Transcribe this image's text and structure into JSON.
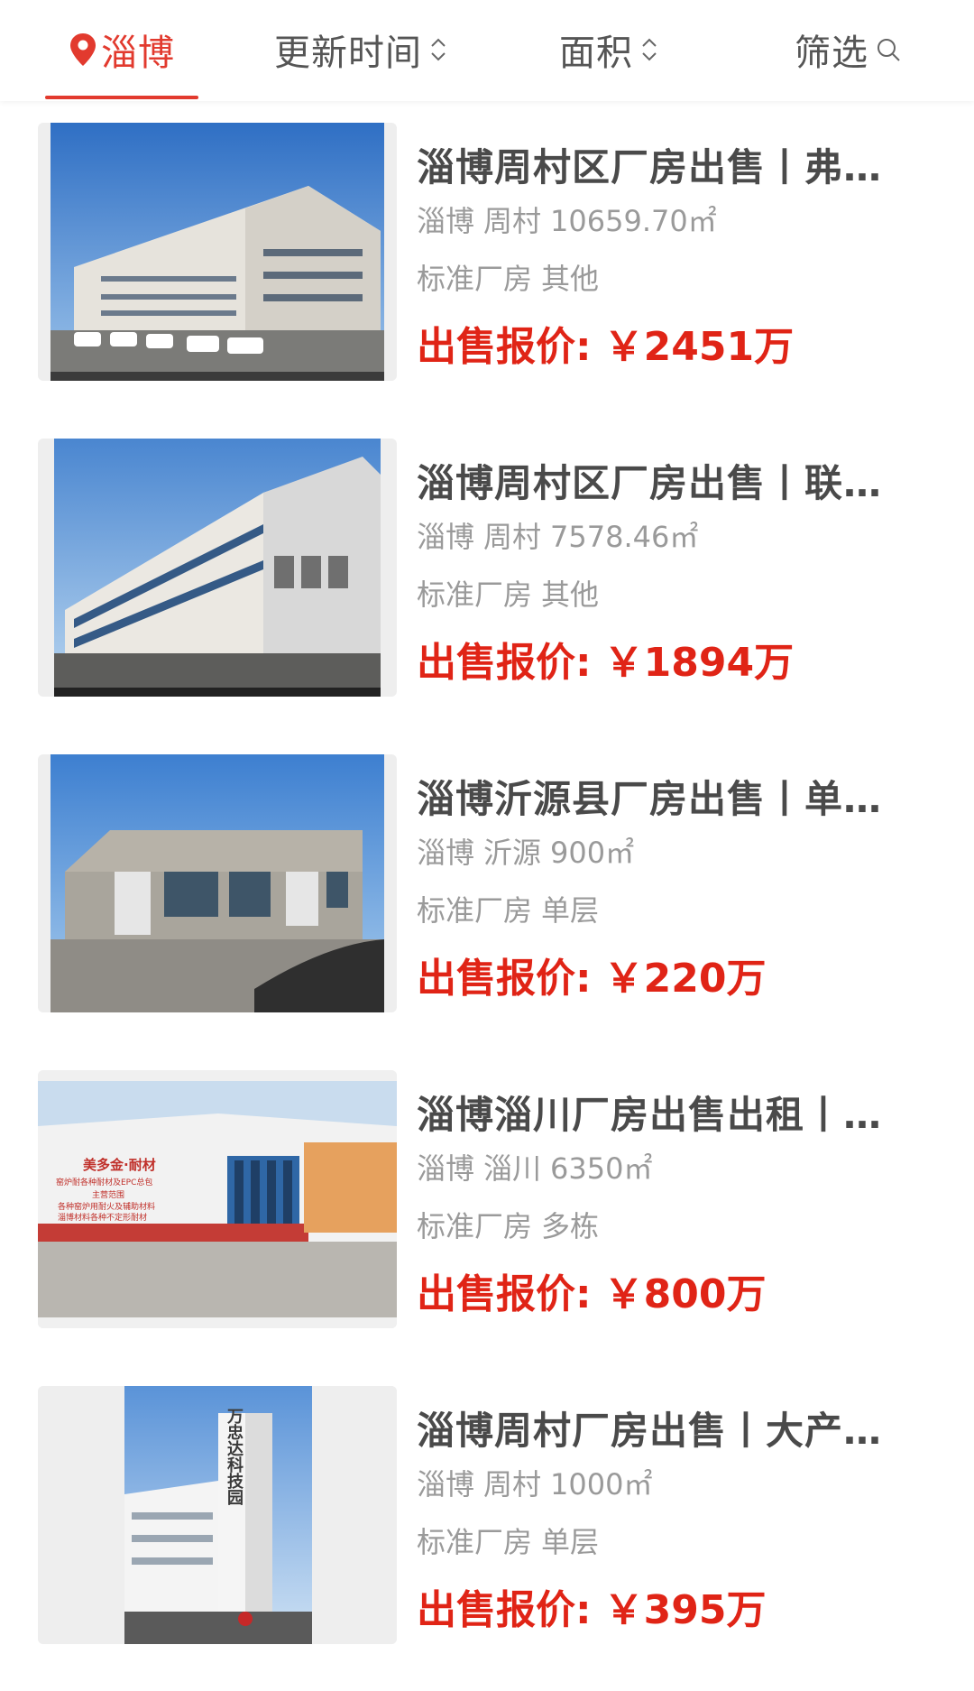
{
  "filters": {
    "city": "淄博",
    "time": "更新时间",
    "area": "面积",
    "filter": "筛选"
  },
  "listings": [
    {
      "title": "淄博周村区厂房出售丨弗…",
      "city": "淄博",
      "district": "周村",
      "area": "10659.70㎡",
      "type": "标准厂房",
      "structure": "其他",
      "price_label": "出售报价:",
      "price": "￥2451万"
    },
    {
      "title": "淄博周村区厂房出售丨联…",
      "city": "淄博",
      "district": "周村",
      "area": "7578.46㎡",
      "type": "标准厂房",
      "structure": "其他",
      "price_label": "出售报价:",
      "price": "￥1894万"
    },
    {
      "title": "淄博沂源县厂房出售丨单…",
      "city": "淄博",
      "district": "沂源",
      "area": "900㎡",
      "type": "标准厂房",
      "structure": "单层",
      "price_label": "出售报价:",
      "price": "￥220万"
    },
    {
      "title": "淄博淄川厂房出售出租丨…",
      "city": "淄博",
      "district": "淄川",
      "area": "6350㎡",
      "type": "标准厂房",
      "structure": "多栋",
      "price_label": "出售报价:",
      "price": "￥800万",
      "wall_text": [
        "美多金·耐材",
        "窑炉耐各种耐材及EPC总包",
        "主营范围",
        "各种窑炉用耐火及辅助材料",
        "淄博材料各种不定形耐材"
      ]
    },
    {
      "title": "淄博周村厂房出售丨大产…",
      "city": "淄博",
      "district": "周村",
      "area": "1000㎡",
      "type": "标准厂房",
      "structure": "单层",
      "price_label": "出售报价:",
      "price": "￥395万",
      "sign_text": "万忠达科技园"
    }
  ],
  "colors": {
    "accent": "#e23a2e",
    "price": "#e02416",
    "title": "#4a4a4a",
    "meta": "#9a9a9a"
  }
}
